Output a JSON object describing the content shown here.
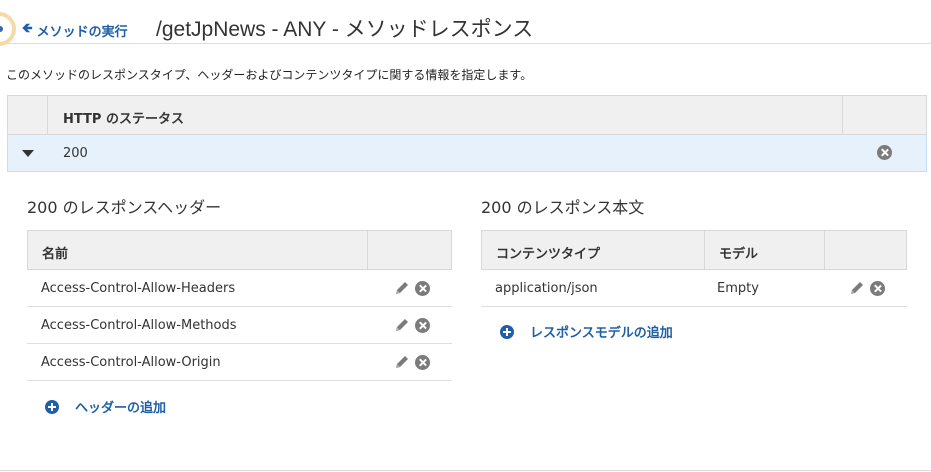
{
  "header": {
    "back_label": "メソッドの実行",
    "title": "/getJpNews - ANY - メソッドレスポンス"
  },
  "description": "このメソッドのレスポンスタイプ、ヘッダーおよびコンテンツタイプに関する情報を指定します。",
  "status_table": {
    "column_header": "HTTP のステータス",
    "rows": [
      {
        "code": "200"
      }
    ]
  },
  "headers_section": {
    "title": "200 のレスポンスヘッダー",
    "column_name": "名前",
    "rows": [
      {
        "name": "Access-Control-Allow-Headers"
      },
      {
        "name": "Access-Control-Allow-Methods"
      },
      {
        "name": "Access-Control-Allow-Origin"
      }
    ],
    "add_label": "ヘッダーの追加"
  },
  "body_section": {
    "title": "200 のレスポンス本文",
    "column_content_type": "コンテンツタイプ",
    "column_model": "モデル",
    "rows": [
      {
        "content_type": "application/json",
        "model": "Empty"
      }
    ],
    "add_label": "レスポンスモデルの追加"
  },
  "colors": {
    "link": "#1f5fa6",
    "selected_row": "#e6f1fb",
    "table_header": "#f0f0f0",
    "icon_gray": "#7b7b7b"
  },
  "icons": [
    "back-arrow-icon",
    "caret-down-icon",
    "remove-icon",
    "edit-pencil-icon",
    "add-plus-icon"
  ]
}
